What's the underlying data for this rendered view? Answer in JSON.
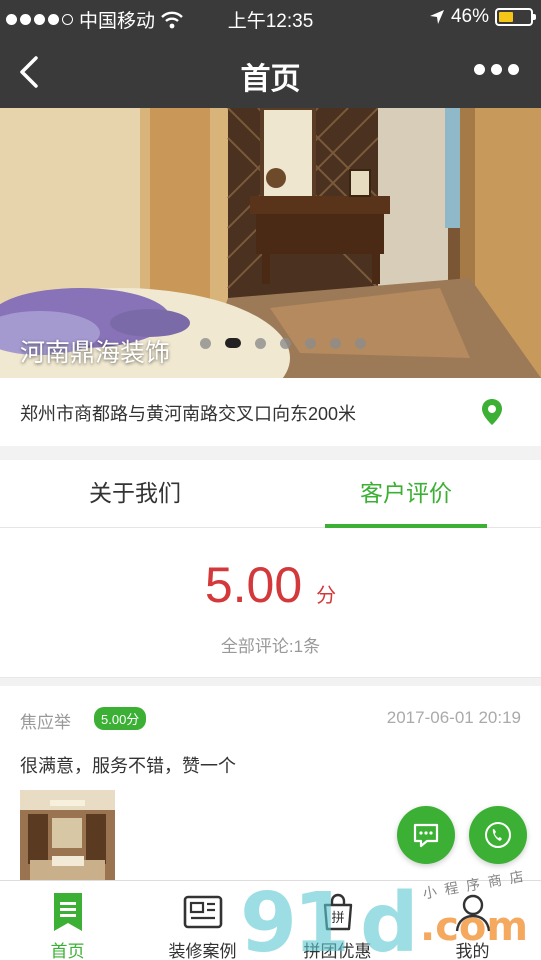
{
  "status_bar": {
    "carrier": "中国移动",
    "time": "上午12:35",
    "battery": "46%",
    "battery_level": 0.46
  },
  "nav": {
    "title": "首页",
    "back_icon": "chevron-left-icon",
    "more_icon": "more-dots-icon"
  },
  "banner": {
    "caption": "河南鼎海装饰",
    "slide_count": 7,
    "active_slide": 1
  },
  "address": {
    "text": "郑州市商都路与黄河南路交叉口向东200米",
    "icon": "location-pin-icon"
  },
  "tabs": [
    {
      "label": "关于我们",
      "active": false
    },
    {
      "label": "客户评价",
      "active": true
    }
  ],
  "rating": {
    "score": "5.00",
    "unit": "分",
    "count_text": "全部评论:1条"
  },
  "review": {
    "name": "焦应举",
    "badge": "5.00分",
    "date": "2017-06-01 20:19",
    "content": "很满意，服务不错，赞一个"
  },
  "colors": {
    "accent": "#3cb034",
    "score": "#d3393b",
    "header": "#3a3a3a"
  },
  "tabbar": [
    {
      "label": "首页",
      "icon": "home-list-icon",
      "active": true
    },
    {
      "label": "装修案例",
      "icon": "newspaper-icon",
      "active": false
    },
    {
      "label": "拼团优惠",
      "icon": "group-buy-icon",
      "glyph": "拼",
      "active": false
    },
    {
      "label": "我的",
      "icon": "user-icon",
      "active": false
    }
  ],
  "watermark": {
    "digits": "91",
    "letter": "d",
    "suffix": ".com",
    "script": "小程序商店"
  }
}
